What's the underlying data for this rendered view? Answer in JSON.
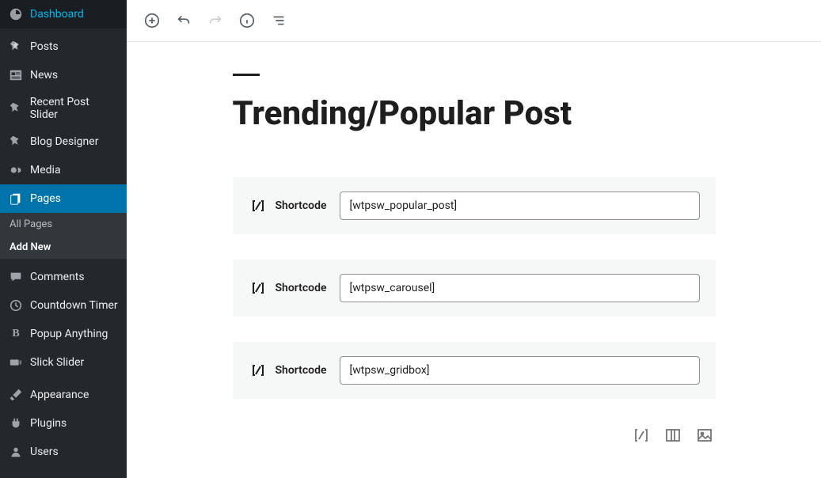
{
  "sidebar": {
    "items": [
      {
        "label": "Dashboard",
        "icon": "dashboard"
      },
      {
        "label": "Posts",
        "icon": "pin"
      },
      {
        "label": "News",
        "icon": "news"
      },
      {
        "label": "Recent Post Slider",
        "icon": "pin"
      },
      {
        "label": "Blog Designer",
        "icon": "pin"
      },
      {
        "label": "Media",
        "icon": "media"
      },
      {
        "label": "Pages",
        "icon": "pages",
        "current": true
      },
      {
        "label": "Comments",
        "icon": "comments"
      },
      {
        "label": "Countdown Timer",
        "icon": "clock"
      },
      {
        "label": "Popup Anything",
        "icon": "bold"
      },
      {
        "label": "Slick Slider",
        "icon": "slider"
      },
      {
        "label": "Appearance",
        "icon": "brush"
      },
      {
        "label": "Plugins",
        "icon": "plug"
      },
      {
        "label": "Users",
        "icon": "user"
      }
    ],
    "submenu": {
      "all_pages": "All Pages",
      "add_new": "Add New"
    }
  },
  "toolbar": {
    "add": "Add block",
    "undo": "Undo",
    "redo": "Redo",
    "info": "Document info",
    "outline": "Block navigation"
  },
  "page": {
    "title": "Trending/Popular Post"
  },
  "blocks": [
    {
      "label": "Shortcode",
      "value": "[wtpsw_popular_post]"
    },
    {
      "label": "Shortcode",
      "value": "[wtpsw_carousel]"
    },
    {
      "label": "Shortcode",
      "value": "[wtpsw_gridbox]"
    }
  ],
  "inserter": {
    "shortcode": "Shortcode",
    "columns": "Columns",
    "image": "Image"
  }
}
